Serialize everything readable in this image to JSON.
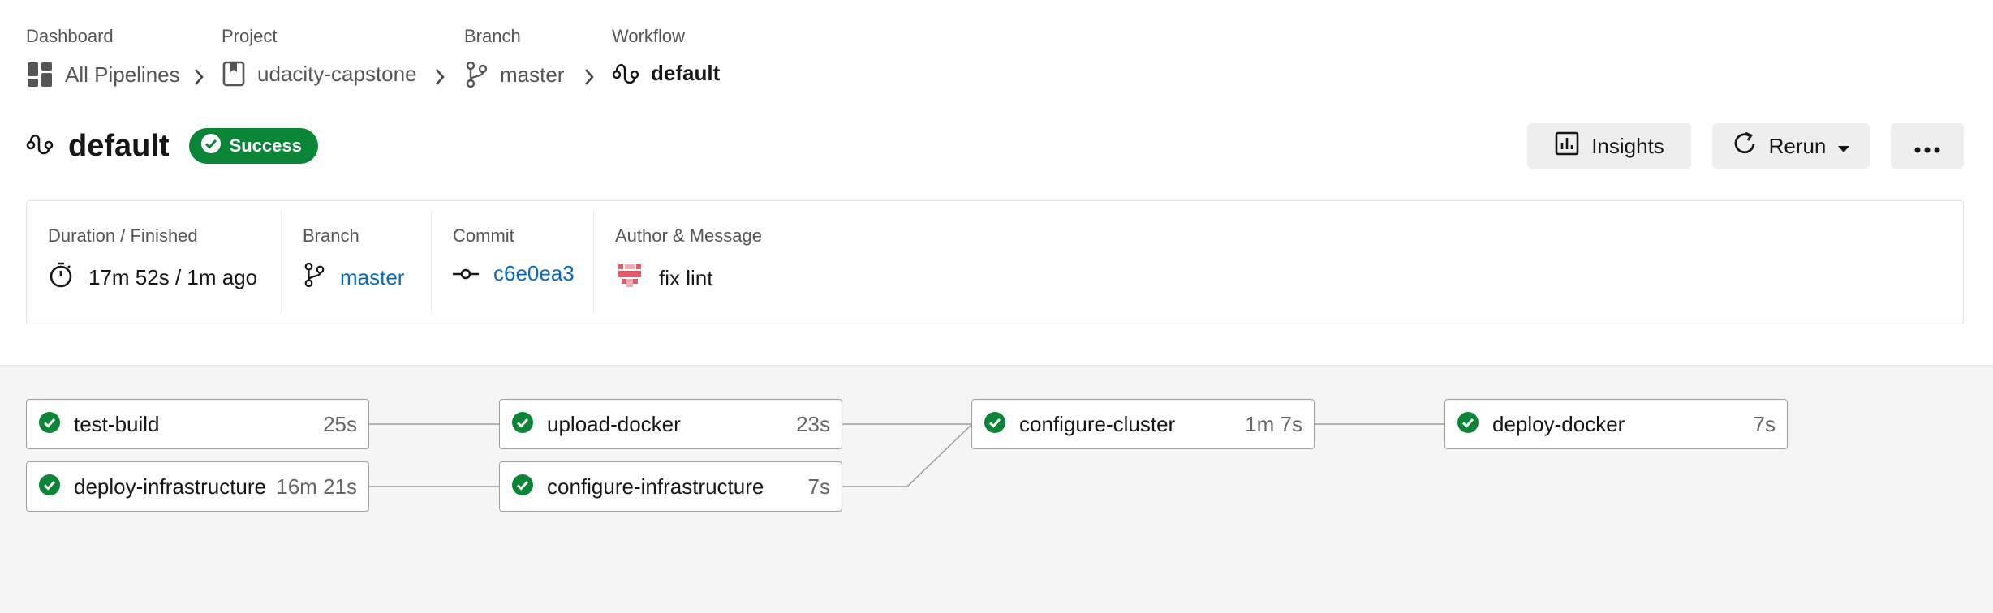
{
  "breadcrumb": {
    "dashboard": {
      "label": "Dashboard",
      "value": "All Pipelines"
    },
    "project": {
      "label": "Project",
      "value": "udacity-capstone"
    },
    "branch": {
      "label": "Branch",
      "value": "master"
    },
    "workflow": {
      "label": "Workflow",
      "value": "default"
    }
  },
  "header": {
    "title": "default",
    "status": "Success",
    "insights_label": "Insights",
    "rerun_label": "Rerun"
  },
  "info": {
    "duration": {
      "label": "Duration / Finished",
      "value": "17m 52s / 1m ago"
    },
    "branch": {
      "label": "Branch",
      "value": "master"
    },
    "commit": {
      "label": "Commit",
      "value": "c6e0ea3"
    },
    "author": {
      "label": "Author & Message",
      "value": "fix lint"
    }
  },
  "jobs": [
    {
      "name": "test-build",
      "duration": "25s"
    },
    {
      "name": "deploy-infrastructure",
      "duration": "16m 21s"
    },
    {
      "name": "upload-docker",
      "duration": "23s"
    },
    {
      "name": "configure-infrastructure",
      "duration": "7s"
    },
    {
      "name": "configure-cluster",
      "duration": "1m 7s"
    },
    {
      "name": "deploy-docker",
      "duration": "7s"
    }
  ],
  "colors": {
    "success": "#0a8437",
    "link": "#0a6ab8",
    "canvas": "#f5f5f5"
  },
  "icons": [
    "dashboard-icon",
    "project-icon",
    "branch-icon",
    "workflow-icon",
    "stopwatch-icon",
    "commit-icon",
    "author-avatar",
    "bar-chart-icon",
    "refresh-icon",
    "more-icon",
    "check-circle-icon",
    "chevron-right-icon"
  ]
}
